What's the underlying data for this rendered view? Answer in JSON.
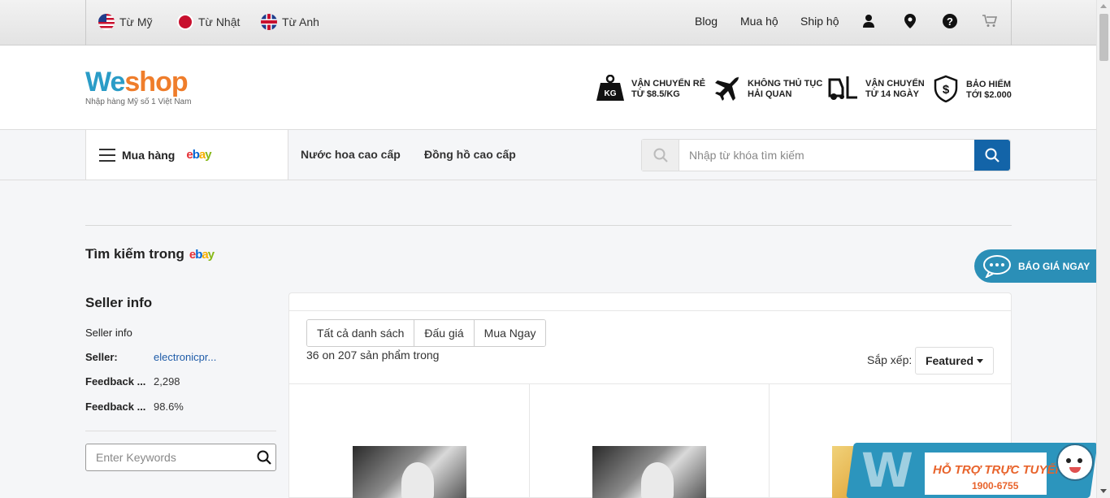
{
  "topbar": {
    "countries": [
      {
        "label": "Từ Mỹ",
        "flag": "us-flag-icon"
      },
      {
        "label": "Từ Nhật",
        "flag": "japan-flag-icon"
      },
      {
        "label": "Từ Anh",
        "flag": "uk-flag-icon"
      }
    ],
    "links": [
      "Blog",
      "Mua hộ",
      "Ship hộ"
    ],
    "icons": [
      "user-icon",
      "location-pin-icon",
      "help-icon",
      "cart-icon"
    ]
  },
  "header": {
    "logo": {
      "part1": "We",
      "part2": "shop",
      "tagline": "Nhập hàng Mỹ số 1 Việt Nam"
    },
    "features": [
      {
        "icon": "weight-kg-icon",
        "line1": "VẬN CHUYỂN RẺ",
        "line2": "TỪ $8.5/KG"
      },
      {
        "icon": "airplane-icon",
        "line1": "KHÔNG THỦ TỤC",
        "line2": "HẢI QUAN"
      },
      {
        "icon": "forklift-icon",
        "line1": "VẬN CHUYỂN",
        "line2": "TỪ 14 NGÀY"
      },
      {
        "icon": "shield-dollar-icon",
        "line1": "BẢO HIỂM",
        "line2": "TỚI $2.000"
      }
    ]
  },
  "nav": {
    "menu_label": "Mua hàng",
    "ebay": {
      "e": "e",
      "b": "b",
      "a": "a",
      "y": "y"
    },
    "links": [
      "Nước hoa cao cấp",
      "Đồng hồ cao cấp"
    ],
    "search_placeholder": "Nhập từ khóa tìm kiếm"
  },
  "content": {
    "search_in_label": "Tìm kiếm trong",
    "sidebar": {
      "title": "Seller info",
      "subtitle": "Seller info",
      "rows": [
        {
          "key": "Seller:",
          "value": "electronicpr..."
        },
        {
          "key": "Feedback ...",
          "value": "2,298"
        },
        {
          "key": "Feedback ...",
          "value": "98.6%"
        }
      ],
      "keyword_placeholder": "Enter Keywords"
    },
    "results": {
      "tabs": [
        "Tất cả danh sách",
        "Đấu giá",
        "Mua Ngay"
      ],
      "count_text": "36 on 207 sản phẩm trong",
      "sort_label": "Sắp xếp:",
      "sort_value": "Featured"
    }
  },
  "widgets": {
    "quote_label": "BÁO GIÁ NGAY",
    "support_title": "HỖ TRỢ TRỰC TUYẾN",
    "support_phone": "1900-6755"
  },
  "colors": {
    "brand_blue": "#2a9cc7",
    "brand_orange": "#ef7d2b",
    "search_button": "#1364a8",
    "link": "#1f5ca8"
  }
}
